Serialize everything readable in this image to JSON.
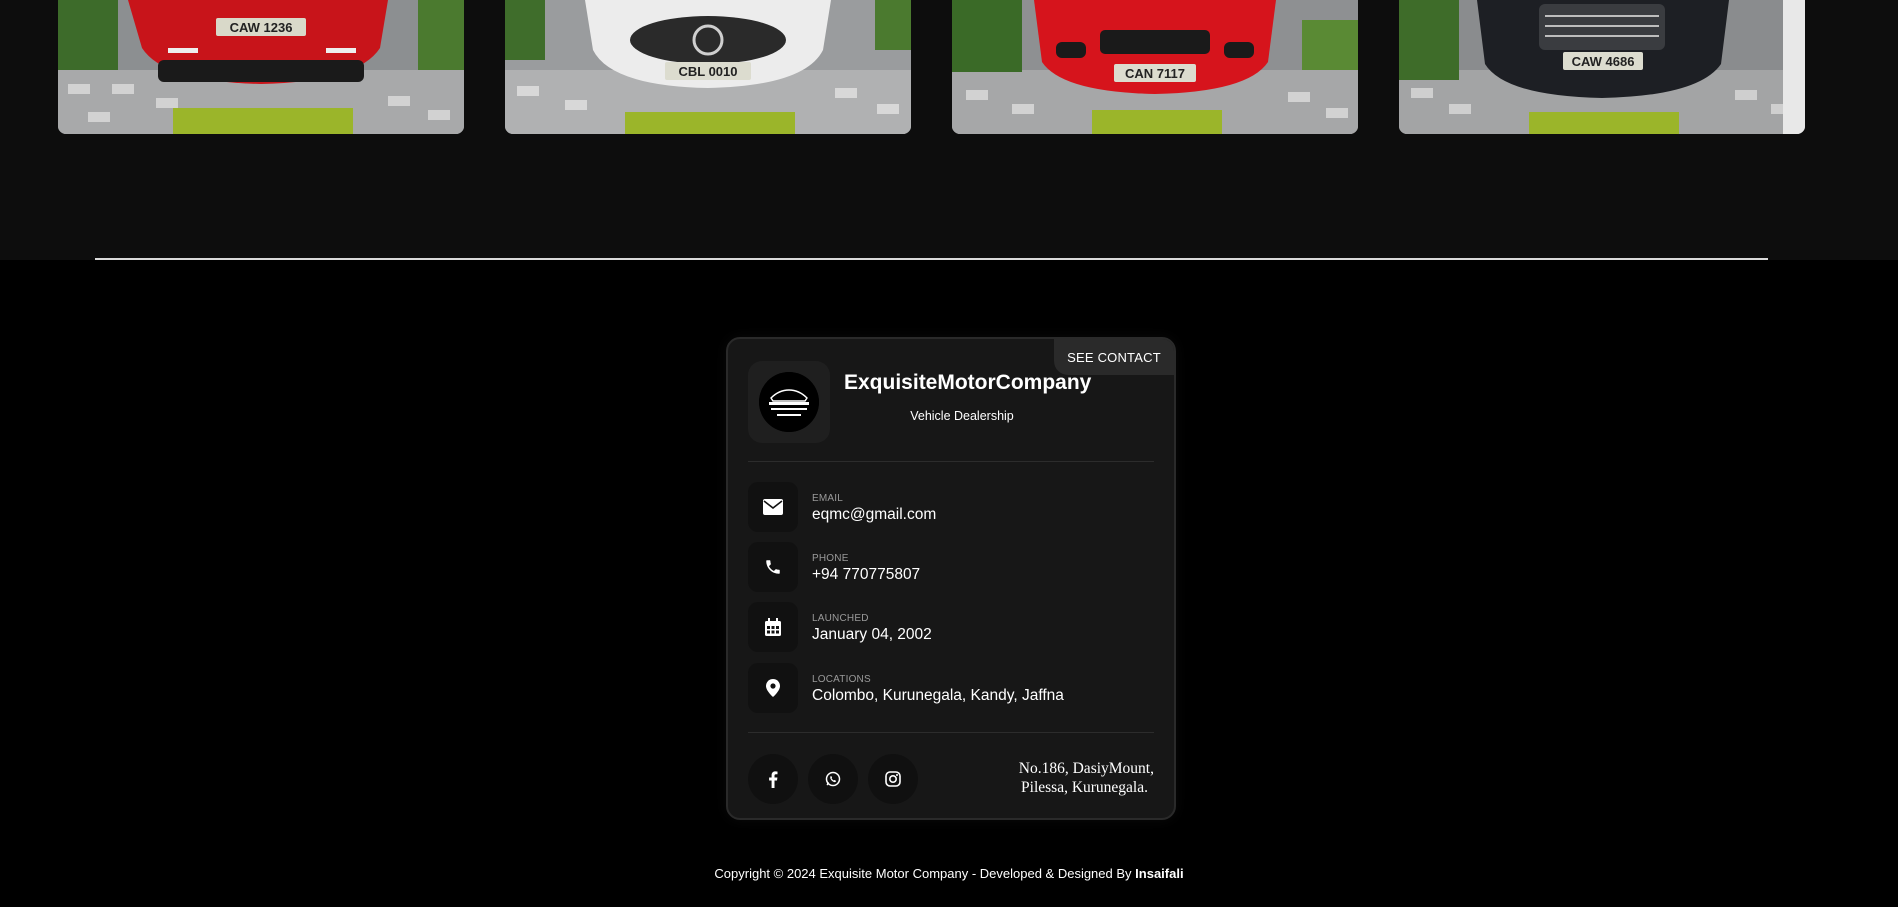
{
  "gallery": {
    "cars": [
      {
        "plate": "CAW 1236",
        "body_color": "#c8141a"
      },
      {
        "plate": "CBL 0010",
        "body_color": "#e8e8e8"
      },
      {
        "plate": "CAN 7117",
        "body_color": "#d6141c"
      },
      {
        "plate": "CAW 4686",
        "body_color": "#1a1c20"
      }
    ]
  },
  "profile": {
    "see_contact_label": "SEE CONTACT",
    "company_name": "ExquisiteMotorCompany",
    "company_type": "Vehicle Dealership",
    "info": [
      {
        "label": "EMAIL",
        "value": "eqmc@gmail.com",
        "icon": "envelope-icon"
      },
      {
        "label": "PHONE",
        "value": "+94 770775807",
        "icon": "phone-icon"
      },
      {
        "label": "LAUNCHED",
        "value": "January 04, 2002",
        "icon": "calendar-icon"
      },
      {
        "label": "LOCATIONS",
        "value": "Colombo, Kurunegala, Kandy, Jaffna",
        "icon": "map-pin-icon"
      }
    ],
    "social": [
      "facebook-icon",
      "whatsapp-icon",
      "instagram-icon"
    ],
    "address_line1": "No.186, DasiyMount,",
    "address_line2": "Pilessa, Kurunegala."
  },
  "footer": {
    "copyright_text": "Copyright © 2024 Exquisite Motor Company - Developed & Designed By ",
    "developer": "Insaifali"
  },
  "colors": {
    "page_bg": "#000000",
    "gallery_bg": "#0d0d0d",
    "card_bg": "#171717",
    "icon_box_bg": "#111111",
    "muted_text": "#9a9a9a"
  }
}
